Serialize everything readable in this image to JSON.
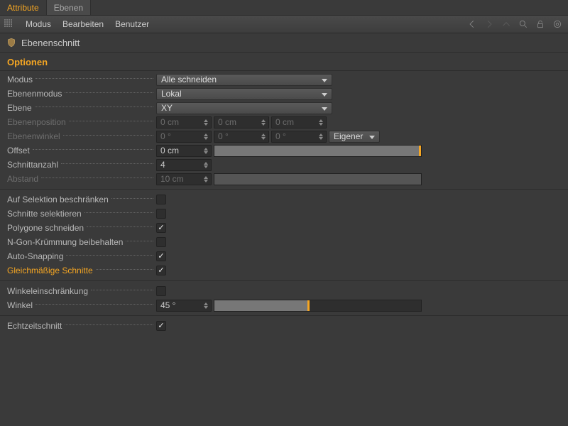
{
  "tabs": {
    "attribute": "Attribute",
    "ebenen": "Ebenen"
  },
  "menu": {
    "modus": "Modus",
    "bearbeiten": "Bearbeiten",
    "benutzer": "Benutzer"
  },
  "title": "Ebenenschnitt",
  "section": "Optionen",
  "rows": {
    "modus": {
      "label": "Modus",
      "value": "Alle schneiden"
    },
    "ebenenmodus": {
      "label": "Ebenenmodus",
      "value": "Lokal"
    },
    "ebene": {
      "label": "Ebene",
      "value": "XY"
    },
    "ebenenposition": {
      "label": "Ebenenposition",
      "x": "0 cm",
      "y": "0 cm",
      "z": "0 cm"
    },
    "ebenenwinkel": {
      "label": "Ebenenwinkel",
      "x": "0 °",
      "y": "0 °",
      "z": "0 °",
      "mode": "Eigener"
    },
    "offset": {
      "label": "Offset",
      "value": "0 cm",
      "fillPct": 99,
      "markPct": 99
    },
    "schnittanzahl": {
      "label": "Schnittanzahl",
      "value": "4"
    },
    "abstand": {
      "label": "Abstand",
      "value": "10 cm",
      "fillPct": 100
    },
    "aufSelektion": {
      "label": "Auf Selektion beschränken",
      "checked": false
    },
    "schnitteSelektieren": {
      "label": "Schnitte selektieren",
      "checked": false
    },
    "polygoneSchneiden": {
      "label": "Polygone schneiden",
      "checked": true
    },
    "ngon": {
      "label": "N-Gon-Krümmung beibehalten",
      "checked": false
    },
    "autoSnapping": {
      "label": "Auto-Snapping",
      "checked": true
    },
    "gleichmaessig": {
      "label": "Gleichmäßige Schnitte",
      "checked": true
    },
    "winkeleinschraenkung": {
      "label": "Winkeleinschränkung",
      "checked": false
    },
    "winkel": {
      "label": "Winkel",
      "value": "45 °",
      "fillPct": 45,
      "markPct": 45
    },
    "echtzeitschnitt": {
      "label": "Echtzeitschnitt",
      "checked": true
    }
  }
}
